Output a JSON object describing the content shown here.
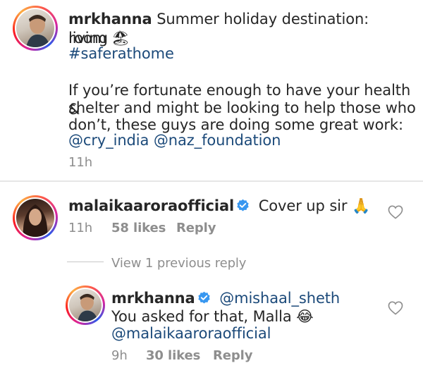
{
  "post": {
    "username": "mrkhanna",
    "caption_lines": [
      "Summer holiday destination: living",
      "room"
    ],
    "emoji_beach": "🏖",
    "hashtag": "#saferathome",
    "body_lines": [
      "If you’re fortunate enough to have your health &",
      "shelter and might be looking to help those who",
      "don’t, these guys are doing some great work:"
    ],
    "mention_1": "@cry_india",
    "mention_2": "@naz_foundation",
    "time": "11h"
  },
  "comment_1": {
    "username": "malaikaaroraofficial",
    "text": "Cover up sir",
    "emoji": "🙏",
    "time": "11h",
    "likes": "58 likes",
    "reply_label": "Reply"
  },
  "view_replies": {
    "label": "View 1 previous reply"
  },
  "reply_1": {
    "username": "mrkhanna",
    "mention": "@mishaal_sheth",
    "text": "You asked for that, Malla",
    "emoji": "😂",
    "mention_2": "@malaikaaroraofficial",
    "time": "9h",
    "likes": "30 likes",
    "reply_label": "Reply"
  },
  "colors": {
    "verified_blue": "#3897f0",
    "link_blue": "#1c4a7a",
    "meta_gray": "#8e8e8e"
  },
  "icons": {
    "verified": "verified-badge-icon",
    "like": "heart-outline-icon"
  }
}
